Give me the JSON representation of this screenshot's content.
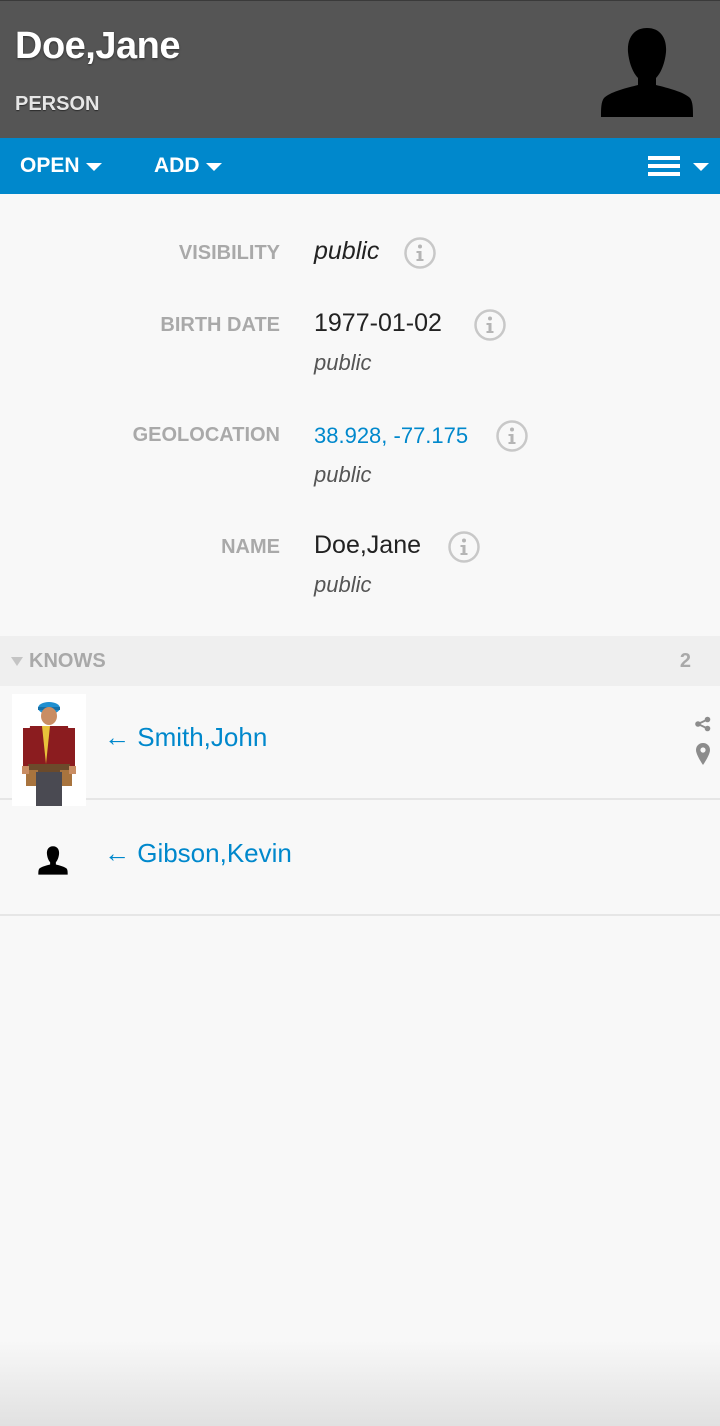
{
  "header": {
    "title": "Doe,Jane",
    "subtitle": "PERSON",
    "avatar_icon": "person-silhouette-icon"
  },
  "toolbar": {
    "open_label": "OPEN",
    "add_label": "ADD",
    "menu_icon": "hamburger-menu-icon"
  },
  "properties": [
    {
      "label": "VISIBILITY",
      "value": "public",
      "visibility": ""
    },
    {
      "label": "BIRTH DATE",
      "value": "1977-01-02",
      "visibility": "public"
    },
    {
      "label": "GEOLOCATION",
      "value": "38.928, -77.175",
      "visibility": "public"
    },
    {
      "label": "NAME",
      "value": "Doe,Jane",
      "visibility": "public"
    }
  ],
  "relations": {
    "title": "KNOWS",
    "count": "2",
    "items": [
      {
        "name": "← Smith,John",
        "thumbnail": "construction-worker-photo"
      },
      {
        "name": "← Gibson,Kevin",
        "thumbnail": "person-silhouette-icon"
      }
    ]
  },
  "colors": {
    "header_bg": "#555555",
    "toolbar_bg": "#0088cc",
    "link": "#0088cc",
    "label": "#a9a9a9"
  }
}
